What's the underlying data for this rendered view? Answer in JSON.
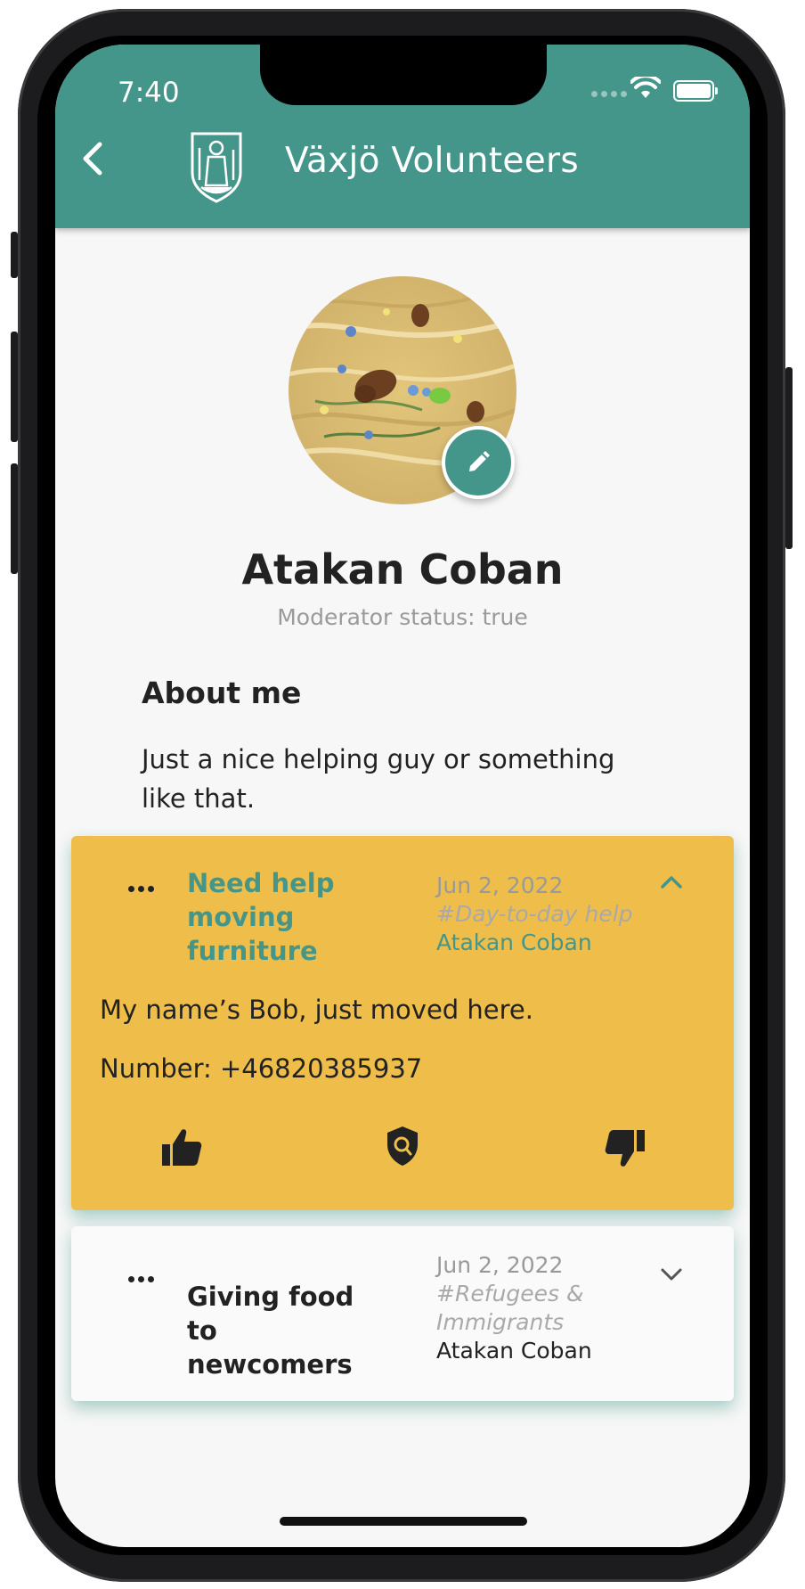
{
  "status_bar": {
    "time": "7:40"
  },
  "app_bar": {
    "title": "Växjö Volunteers"
  },
  "profile": {
    "name": "Atakan Coban",
    "moderator_status": "Moderator status: true",
    "about_heading": "About me",
    "about_text": "Just a nice helping guy or something like that."
  },
  "posts": [
    {
      "title": "Need help moving furniture",
      "date": "Jun 2, 2022",
      "category": "#Day-to-day help",
      "author": "Atakan Coban",
      "expanded": true,
      "body_line1": "My name’s Bob, just moved here.",
      "body_line2": "Number: +46820385937",
      "background": "#efbe4a"
    },
    {
      "title": "Giving food to newcomers",
      "date": "Jun 2, 2022",
      "category": "#Refugees & Immigrants",
      "author": "Atakan Coban",
      "expanded": false,
      "background": "#fafafa"
    }
  ],
  "colors": {
    "primary": "#45968a",
    "highlight_card": "#efbe4a",
    "background": "#f7f7f7"
  },
  "icons": [
    "back-arrow-icon",
    "town-crest-logo-icon",
    "edit-pencil-icon",
    "more-dots-icon",
    "chevron-up-icon",
    "chevron-down-icon",
    "thumbs-up-icon",
    "shield-search-icon",
    "thumbs-down-icon",
    "wifi-icon",
    "battery-icon"
  ]
}
